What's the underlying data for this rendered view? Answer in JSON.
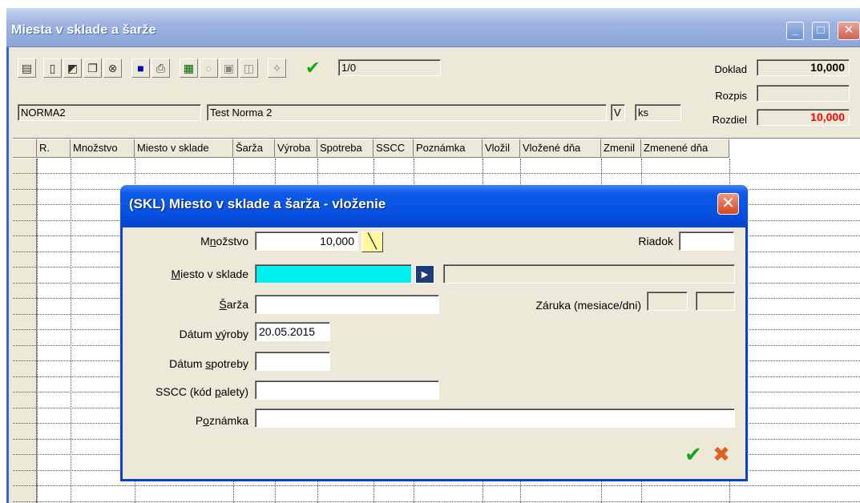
{
  "window": {
    "title": "Miesta v sklade a šarže"
  },
  "toolbar": {
    "icons": [
      "document-icon",
      "new-file-icon",
      "open-folder-icon",
      "copy-icon",
      "delete-icon",
      "monitor-icon",
      "print-icon",
      "grid-icon",
      "circle-icon",
      "calendar-icon",
      "export-icon",
      "magic-wand-icon",
      "check-icon"
    ],
    "record_counter": "1/0"
  },
  "header": {
    "code": "NORMA2",
    "name": "Test Norma 2",
    "flag": "V",
    "unit": "ks",
    "doklad_label": "Doklad",
    "doklad_value": "10,000",
    "rozpis_label": "Rozpis",
    "rozpis_value": "",
    "rozdiel_label": "Rozdiel",
    "rozdiel_value": "10,000"
  },
  "colors": {
    "rozdiel_value": "#ff0000",
    "miesto_field": "#00f0f0",
    "dialog_title_bg": "#0550e0"
  },
  "grid": {
    "columns": [
      "R.",
      "Množstvo",
      "Miesto v sklade",
      "Šarža",
      "Výroba",
      "Spotreba",
      "SSCC",
      "Poznámka",
      "Vložil",
      "Vložené dňa",
      "Zmenil",
      "Zmenené dňa"
    ]
  },
  "dialog": {
    "title": "(SKL) Miesto v sklade a šarža - vloženie",
    "mnozstvo": {
      "pre": "M",
      "ul": "n",
      "post": "ožstvo",
      "value": "10,000"
    },
    "riadok_label": "Riadok",
    "riadok_value": "",
    "miesto": {
      "pre": "",
      "ul": "M",
      "post": "iesto v sklade",
      "value": ""
    },
    "sarza": {
      "pre": "",
      "ul": "Š",
      "post": "arža",
      "value": ""
    },
    "zaruka_label": "Záruka (mesiace/dni)",
    "zaruka_months": "",
    "zaruka_days": "",
    "vyroba": {
      "pre": "Dátum ",
      "ul": "v",
      "post": "ýroby",
      "value": "20.05.2015"
    },
    "spotreba": {
      "pre": "Dátum ",
      "ul": "s",
      "post": "potreby",
      "value": ""
    },
    "sscc": {
      "pre": "SSCC (kód ",
      "ul": "p",
      "post": "alety)",
      "value": ""
    },
    "poznamka": {
      "pre": "P",
      "ul": "o",
      "post": "známka",
      "value": ""
    }
  }
}
